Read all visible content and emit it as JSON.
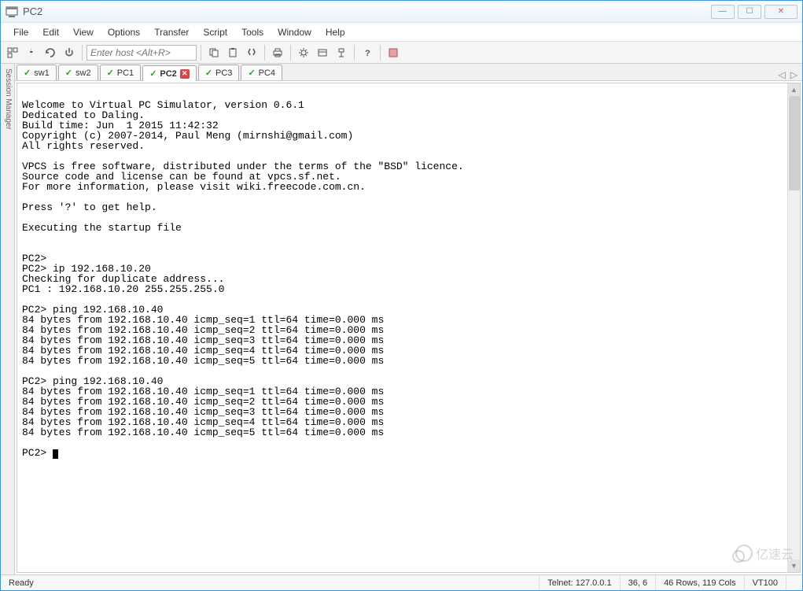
{
  "window": {
    "title": "PC2"
  },
  "menu": {
    "items": [
      "File",
      "Edit",
      "View",
      "Options",
      "Transfer",
      "Script",
      "Tools",
      "Window",
      "Help"
    ]
  },
  "toolbar": {
    "host_placeholder": "Enter host <Alt+R>"
  },
  "side_label": "Session Manager",
  "tabs": [
    {
      "label": "sw1",
      "active": false
    },
    {
      "label": "sw2",
      "active": false
    },
    {
      "label": "PC1",
      "active": false
    },
    {
      "label": "PC2",
      "active": true,
      "closable": true
    },
    {
      "label": "PC3",
      "active": false
    },
    {
      "label": "PC4",
      "active": false
    }
  ],
  "terminal": {
    "lines": [
      "",
      "Welcome to Virtual PC Simulator, version 0.6.1",
      "Dedicated to Daling.",
      "Build time: Jun  1 2015 11:42:32",
      "Copyright (c) 2007-2014, Paul Meng (mirnshi@gmail.com)",
      "All rights reserved.",
      "",
      "VPCS is free software, distributed under the terms of the \"BSD\" licence.",
      "Source code and license can be found at vpcs.sf.net.",
      "For more information, please visit wiki.freecode.com.cn.",
      "",
      "Press '?' to get help.",
      "",
      "Executing the startup file",
      "",
      "",
      "PC2>",
      "PC2> ip 192.168.10.20",
      "Checking for duplicate address...",
      "PC1 : 192.168.10.20 255.255.255.0",
      "",
      "PC2> ping 192.168.10.40",
      "84 bytes from 192.168.10.40 icmp_seq=1 ttl=64 time=0.000 ms",
      "84 bytes from 192.168.10.40 icmp_seq=2 ttl=64 time=0.000 ms",
      "84 bytes from 192.168.10.40 icmp_seq=3 ttl=64 time=0.000 ms",
      "84 bytes from 192.168.10.40 icmp_seq=4 ttl=64 time=0.000 ms",
      "84 bytes from 192.168.10.40 icmp_seq=5 ttl=64 time=0.000 ms",
      "",
      "PC2> ping 192.168.10.40",
      "84 bytes from 192.168.10.40 icmp_seq=1 ttl=64 time=0.000 ms",
      "84 bytes from 192.168.10.40 icmp_seq=2 ttl=64 time=0.000 ms",
      "84 bytes from 192.168.10.40 icmp_seq=3 ttl=64 time=0.000 ms",
      "84 bytes from 192.168.10.40 icmp_seq=4 ttl=64 time=0.000 ms",
      "84 bytes from 192.168.10.40 icmp_seq=5 ttl=64 time=0.000 ms",
      "",
      "PC2> "
    ]
  },
  "status": {
    "ready": "Ready",
    "conn": "Telnet: 127.0.0.1",
    "pos": "36,   6",
    "size": "46 Rows, 119 Cols",
    "emul": "VT100"
  },
  "watermark": "亿速云"
}
